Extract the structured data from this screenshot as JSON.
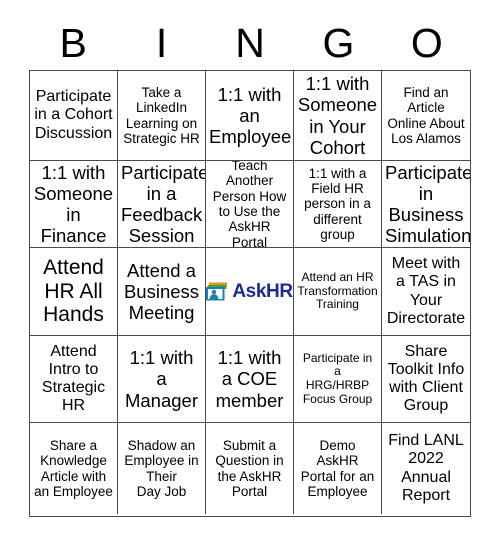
{
  "card": {
    "title": "BINGO",
    "header_letters": [
      "B",
      "I",
      "N",
      "G",
      "O"
    ],
    "grid_columns": 5,
    "grid_rows": 5,
    "border_color": "#4a4a4a",
    "background_color": "#ffffff",
    "text_color": "#000000"
  },
  "logo": {
    "name": "askhr-logo",
    "text": "AskHR",
    "text_color": "#1f2b8f",
    "icon_name": "askhr-cards-person-icon",
    "icon_colors": {
      "orange": "#f18b21",
      "green": "#3aa935",
      "teal": "#1b7fb4",
      "blue": "#1f2b8f",
      "white": "#ffffff"
    }
  },
  "cells": [
    {
      "row": 1,
      "col": 1,
      "column_letter": "B",
      "text": "Participate\nin a Cohort\nDiscussion",
      "size": "md",
      "type": "text"
    },
    {
      "row": 1,
      "col": 2,
      "column_letter": "I",
      "text": "Take a\nLinkedIn\nLearning on\nStrategic HR",
      "size": "sm",
      "type": "text"
    },
    {
      "row": 1,
      "col": 3,
      "column_letter": "N",
      "text": "1:1 with\nan\nEmployee",
      "size": "lg",
      "type": "text"
    },
    {
      "row": 1,
      "col": 4,
      "column_letter": "G",
      "text": "1:1 with\nSomeone\nin Your\nCohort",
      "size": "lg",
      "type": "text"
    },
    {
      "row": 1,
      "col": 5,
      "column_letter": "O",
      "text": "Find an\nArticle\nOnline About\nLos Alamos",
      "size": "sm",
      "type": "text"
    },
    {
      "row": 2,
      "col": 1,
      "column_letter": "B",
      "text": "1:1 with\nSomeone\nin Finance",
      "size": "lg",
      "type": "text"
    },
    {
      "row": 2,
      "col": 2,
      "column_letter": "I",
      "text": "Participate\nin a\nFeedback\nSession",
      "size": "lg",
      "type": "text"
    },
    {
      "row": 2,
      "col": 3,
      "column_letter": "N",
      "text": "Teach\nAnother\nPerson How\nto Use the\nAskHR Portal",
      "size": "sm",
      "type": "text"
    },
    {
      "row": 2,
      "col": 4,
      "column_letter": "G",
      "text": "1:1 with a\nField HR\nperson in a\ndifferent\ngroup",
      "size": "sm",
      "type": "text"
    },
    {
      "row": 2,
      "col": 5,
      "column_letter": "O",
      "text": "Participate\nin\nBusiness\nSimulation",
      "size": "lg",
      "type": "text"
    },
    {
      "row": 3,
      "col": 1,
      "column_letter": "B",
      "text": "Attend\nHR All\nHands",
      "size": "xl",
      "type": "text"
    },
    {
      "row": 3,
      "col": 2,
      "column_letter": "I",
      "text": "Attend a\nBusiness\nMeeting",
      "size": "lg",
      "type": "text"
    },
    {
      "row": 3,
      "col": 3,
      "column_letter": "N",
      "text": "AskHR",
      "size": "md",
      "type": "logo"
    },
    {
      "row": 3,
      "col": 4,
      "column_letter": "G",
      "text": "Attend an HR\nTransformation\nTraining",
      "size": "xs",
      "type": "text"
    },
    {
      "row": 3,
      "col": 5,
      "column_letter": "O",
      "text": "Meet with\na TAS in\nYour\nDirectorate",
      "size": "md",
      "type": "text"
    },
    {
      "row": 4,
      "col": 1,
      "column_letter": "B",
      "text": "Attend\nIntro to\nStrategic\nHR",
      "size": "md",
      "type": "text"
    },
    {
      "row": 4,
      "col": 2,
      "column_letter": "I",
      "text": "1:1 with\na\nManager",
      "size": "lg",
      "type": "text"
    },
    {
      "row": 4,
      "col": 3,
      "column_letter": "N",
      "text": "1:1 with\na COE\nmember",
      "size": "lg",
      "type": "text"
    },
    {
      "row": 4,
      "col": 4,
      "column_letter": "G",
      "text": "Participate in\na\nHRG/HRBP\nFocus Group",
      "size": "xs",
      "type": "text"
    },
    {
      "row": 4,
      "col": 5,
      "column_letter": "O",
      "text": "Share\nToolkit Info\nwith Client\nGroup",
      "size": "md",
      "type": "text"
    },
    {
      "row": 5,
      "col": 1,
      "column_letter": "B",
      "text": "Share a\nKnowledge\nArticle with\nan Employee",
      "size": "sm",
      "type": "text"
    },
    {
      "row": 5,
      "col": 2,
      "column_letter": "I",
      "text": "Shadow an\nEmployee in\nTheir\nDay Job",
      "size": "sm",
      "type": "text"
    },
    {
      "row": 5,
      "col": 3,
      "column_letter": "N",
      "text": "Submit a\nQuestion in\nthe AskHR\nPortal",
      "size": "sm",
      "type": "text"
    },
    {
      "row": 5,
      "col": 4,
      "column_letter": "G",
      "text": "Demo\nAskHR\nPortal for an\nEmployee",
      "size": "sm",
      "type": "text"
    },
    {
      "row": 5,
      "col": 5,
      "column_letter": "O",
      "text": "Find LANL\n2022\nAnnual\nReport",
      "size": "md",
      "type": "text"
    }
  ]
}
